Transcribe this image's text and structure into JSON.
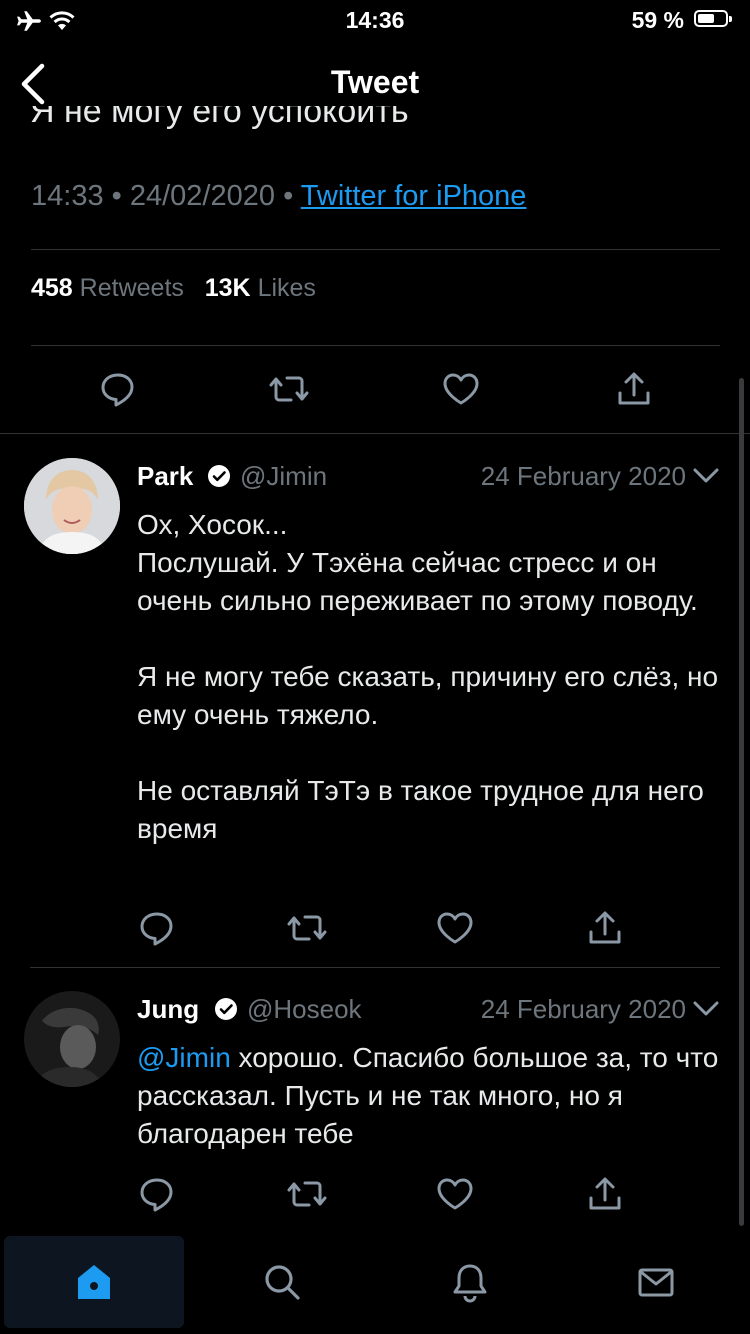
{
  "status_bar": {
    "time": "14:36",
    "battery": "59 %"
  },
  "header": {
    "title": "Tweet"
  },
  "main_tweet": {
    "partial_text": "Я не могу его успокоить",
    "time": "14:33",
    "date": "24/02/2020",
    "separator": "•",
    "source": "Twitter for iPhone",
    "retweets_count": "458",
    "retweets_label": "Retweets",
    "likes_count": "13K",
    "likes_label": "Likes"
  },
  "replies": [
    {
      "name": "Park",
      "handle": "@Jimin",
      "date": "24 February 2020",
      "paragraphs": [
        "Ох, Хосок...",
        "Послушай. У Тэхёна сейчас стресс и он очень сильно переживает по этому поводу.",
        "",
        "Я не могу тебе сказать, причину его слёз, но ему очень тяжело.",
        "",
        "Не оставляй ТэТэ в такое трудное для него время"
      ]
    },
    {
      "name": "Jung",
      "handle": "@Hoseok",
      "date": "24 February 2020",
      "mention": "@Jimin",
      "text": " хорошо. Спасибо большое за, то что рассказал. Пусть и не так много, но я благодарен тебе"
    }
  ],
  "colors": {
    "accent": "#1d9bf0",
    "muted": "#6e767d",
    "divider": "#2f3336",
    "background": "#000000"
  },
  "tab_bar": {
    "icons": [
      "home-icon",
      "search-icon",
      "bell-icon",
      "mail-icon"
    ],
    "active": "home-icon"
  }
}
